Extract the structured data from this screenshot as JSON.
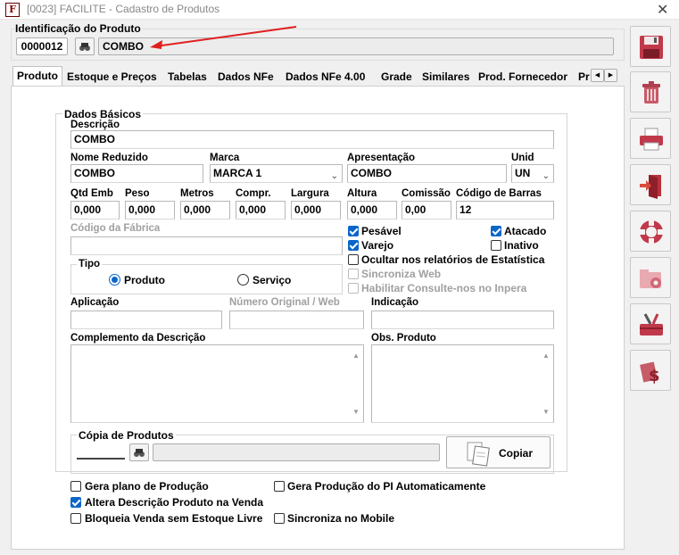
{
  "window": {
    "title": "[0023] FACILITE - Cadastro de Produtos",
    "app_icon": "F",
    "close": "✕"
  },
  "header": {
    "group_label": "Identificação do Produto",
    "code": "0000012",
    "name": "COMBO"
  },
  "tabs": [
    "Produto",
    "Estoque e Preços",
    "Tabelas",
    "Dados NFe",
    "Dados NFe 4.00",
    "Grade",
    "Similares",
    "Prod. Fornecedor",
    "Pr"
  ],
  "tab_scroll": {
    "left": "◀",
    "right": "▶"
  },
  "basic": {
    "group_label": "Dados Básicos",
    "descricao_label": "Descrição",
    "descricao": "COMBO",
    "nome_reduzido_label": "Nome Reduzido",
    "nome_reduzido": "COMBO",
    "marca_label": "Marca",
    "marca": "MARCA 1",
    "apresentacao_label": "Apresentação",
    "apresentacao": "COMBO",
    "unid_label": "Unid",
    "unid": "UN",
    "qtd_emb_label": "Qtd Emb",
    "qtd_emb": "0,000",
    "peso_label": "Peso",
    "peso": "0,000",
    "metros_label": "Metros",
    "metros": "0,000",
    "compr_label": "Compr.",
    "compr": "0,000",
    "largura_label": "Largura",
    "largura": "0,000",
    "altura_label": "Altura",
    "altura": "0,000",
    "comissao_label": "Comissão",
    "comissao": "0,00",
    "barras_label": "Código de Barras",
    "barras": "12",
    "fabrica_label": "Código da Fábrica",
    "tipo_label": "Tipo",
    "produto": "Produto",
    "servico": "Serviço",
    "pesavel": "Pesável",
    "atacado": "Atacado",
    "varejo": "Varejo",
    "inativo": "Inativo",
    "ocultar": "Ocultar nos relatórios de Estatística",
    "sincroniza_web": "Sincroniza Web",
    "habilitar": "Habilitar Consulte-nos no Inpera",
    "aplicacao_label": "Aplicação",
    "num_original_label": "Número Original / Web",
    "indicacao_label": "Indicação",
    "complemento_label": "Complemento da Descrição",
    "obs_label": "Obs. Produto"
  },
  "copia": {
    "label": "Cópia de Produtos",
    "button": "Copiar"
  },
  "options": {
    "gera_plano": "Gera plano de Produção",
    "gera_producao": "Gera Produção do PI Automaticamente",
    "altera_desc": "Altera Descrição Produto na Venda",
    "bloqueia": "Bloqueia Venda sem Estoque Livre",
    "sincroniza_mobile": "Sincroniza no Mobile"
  },
  "colors": {
    "accent": "#0b66c9",
    "arrow": "#e02020"
  }
}
